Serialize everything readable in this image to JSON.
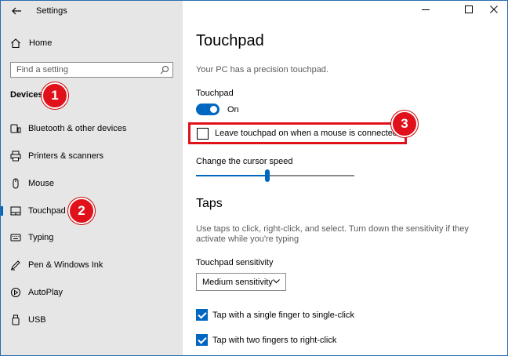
{
  "window": {
    "title": "Settings"
  },
  "sidebar": {
    "home_label": "Home",
    "search_placeholder": "Find a setting",
    "section_title": "Devices",
    "items": [
      {
        "label": "Bluetooth & other devices",
        "icon": "bluetooth-devices-icon"
      },
      {
        "label": "Printers & scanners",
        "icon": "printer-icon"
      },
      {
        "label": "Mouse",
        "icon": "mouse-icon"
      },
      {
        "label": "Touchpad",
        "icon": "touchpad-icon",
        "selected": true
      },
      {
        "label": "Typing",
        "icon": "keyboard-icon"
      },
      {
        "label": "Pen & Windows Ink",
        "icon": "pen-icon"
      },
      {
        "label": "AutoPlay",
        "icon": "autoplay-icon"
      },
      {
        "label": "USB",
        "icon": "usb-icon"
      }
    ]
  },
  "badges": {
    "one": "1",
    "two": "2",
    "three": "3"
  },
  "main": {
    "title": "Touchpad",
    "subtitle": "Your PC has a precision touchpad.",
    "touchpad_label": "Touchpad",
    "toggle_state": "On",
    "leave_on_label": "Leave touchpad on when a mouse is connected",
    "cursor_speed_label": "Change the cursor speed",
    "cursor_speed_value": 0.45,
    "taps_title": "Taps",
    "taps_description_line1": "Use taps to click, right-click, and select. Turn down the sensitivity if they",
    "taps_description_line2": "activate while you're typing",
    "sensitivity_label": "Touchpad sensitivity",
    "sensitivity_value": "Medium sensitivity",
    "tap_single_label": "Tap with a single finger to single-click",
    "tap_two_label": "Tap with two fingers to right-click"
  },
  "colors": {
    "accent": "#0067c0",
    "highlight": "#e0111a",
    "sidebar_bg": "#e6e6e6"
  }
}
